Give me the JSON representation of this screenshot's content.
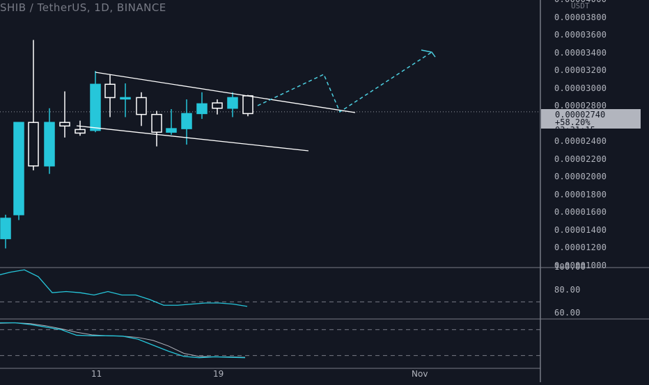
{
  "header": {
    "symbol_title": "SHIB / TetherUS, 1D, BINANCE",
    "currency": "USDT"
  },
  "price_badge": {
    "price": "0.00002740",
    "change": "+58.20%",
    "countdown": "03:31:15"
  },
  "colors": {
    "background": "#131722",
    "bull": "#26c6da",
    "bear": "#ffffff",
    "pattern_line": "#ffffff",
    "projection": "#4dd0e1",
    "oscillator_main": "#26c6da",
    "oscillator_signal": "#b2b5be",
    "grid_divider": "#787b86"
  },
  "chart_data": [
    {
      "type": "candlestick",
      "title": "SHIB / TetherUS, 1D, BINANCE",
      "ylabel": "USDT",
      "y_ticks": [
        "0.00001000",
        "0.00001200",
        "0.00001400",
        "0.00001600",
        "0.00001800",
        "0.00002000",
        "0.00002200",
        "0.00002400",
        "0.00002800",
        "0.00003000",
        "0.00003200",
        "0.00003400",
        "0.00003600",
        "0.00003800",
        "0.00004000"
      ],
      "ylim": [
        1e-05,
        4e-05
      ],
      "x_ticks": [
        "11",
        "19",
        "Nov"
      ],
      "candles": [
        {
          "o": 1.31e-05,
          "h": 1.58e-05,
          "l": 1.2e-05,
          "c": 1.54e-05
        },
        {
          "o": 1.58e-05,
          "h": 2.02e-05,
          "l": 1.52e-05,
          "c": 2.62e-05
        },
        {
          "o": 2.62e-05,
          "h": 3.55e-05,
          "l": 2.08e-05,
          "c": 2.13e-05
        },
        {
          "o": 2.13e-05,
          "h": 2.78e-05,
          "l": 2.04e-05,
          "c": 2.62e-05
        },
        {
          "o": 2.62e-05,
          "h": 2.97e-05,
          "l": 2.45e-05,
          "c": 2.58e-05
        },
        {
          "o": 2.54e-05,
          "h": 2.64e-05,
          "l": 2.47e-05,
          "c": 2.5e-05
        },
        {
          "o": 2.53e-05,
          "h": 3.2e-05,
          "l": 2.51e-05,
          "c": 3.05e-05
        },
        {
          "o": 3.05e-05,
          "h": 3.16e-05,
          "l": 2.68e-05,
          "c": 2.9e-05
        },
        {
          "o": 2.9e-05,
          "h": 3.06e-05,
          "l": 2.68e-05,
          "c": 2.9e-05
        },
        {
          "o": 2.9e-05,
          "h": 2.96e-05,
          "l": 2.58e-05,
          "c": 2.71e-05
        },
        {
          "o": 2.71e-05,
          "h": 2.75e-05,
          "l": 2.35e-05,
          "c": 2.51e-05
        },
        {
          "o": 2.51e-05,
          "h": 2.77e-05,
          "l": 2.48e-05,
          "c": 2.55e-05
        },
        {
          "o": 2.55e-05,
          "h": 2.88e-05,
          "l": 2.37e-05,
          "c": 2.72e-05
        },
        {
          "o": 2.72e-05,
          "h": 2.96e-05,
          "l": 2.66e-05,
          "c": 2.83e-05
        },
        {
          "o": 2.84e-05,
          "h": 2.88e-05,
          "l": 2.71e-05,
          "c": 2.78e-05
        },
        {
          "o": 2.78e-05,
          "h": 2.96e-05,
          "l": 2.68e-05,
          "c": 2.9e-05
        },
        {
          "o": 2.92e-05,
          "h": 2.93e-05,
          "l": 2.69e-05,
          "c": 2.72e-05
        }
      ],
      "current_price": 2.74e-05
    },
    {
      "type": "line",
      "panel": "oscillator-1",
      "y_ticks": [
        "100.00",
        "80.00",
        "60.00"
      ],
      "ylim": [
        55,
        100
      ],
      "threshold": 70,
      "values": [
        93,
        96,
        98,
        92,
        78,
        79,
        78,
        76,
        79,
        76,
        76,
        72,
        67,
        67,
        68,
        69,
        69,
        68,
        66
      ]
    },
    {
      "type": "line",
      "panel": "oscillator-2",
      "ylim": [
        0,
        100
      ],
      "thresholds": [
        80,
        20
      ],
      "series": [
        {
          "values": [
            96,
            96,
            92,
            86,
            80,
            67,
            66,
            66,
            65,
            58,
            44,
            30,
            18,
            15,
            17,
            16,
            15
          ]
        },
        {
          "values": [
            95,
            96,
            94,
            89,
            82,
            74,
            68,
            66,
            65,
            62,
            55,
            42,
            25,
            18,
            17,
            17,
            16
          ]
        }
      ]
    }
  ]
}
